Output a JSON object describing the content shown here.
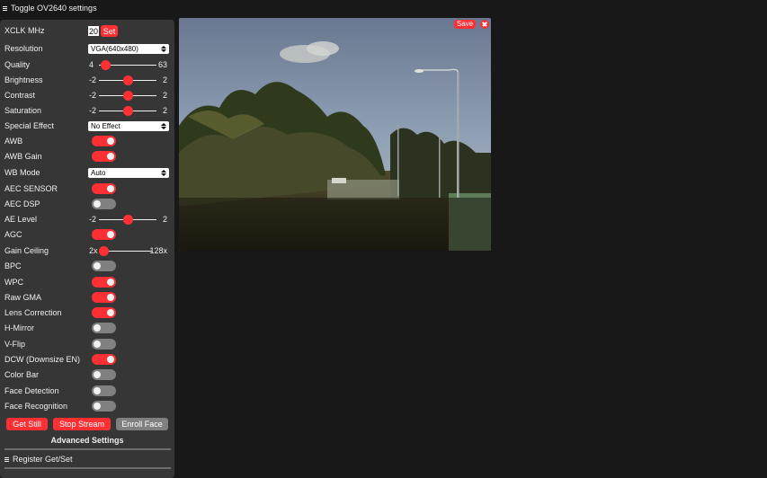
{
  "header": {
    "toggle_label": "Toggle OV2640 settings",
    "icon": "menu-icon"
  },
  "xclk": {
    "label": "XCLK MHz",
    "value": "20",
    "set_label": "Set"
  },
  "selects": {
    "resolution": {
      "label": "Resolution",
      "value": "VGA(640x480)"
    },
    "special_effect": {
      "label": "Special Effect",
      "value": "No Effect"
    },
    "wb_mode": {
      "label": "WB Mode",
      "value": "Auto"
    }
  },
  "sliders": {
    "quality": {
      "label": "Quality",
      "min": "4",
      "max": "63",
      "value": 10
    },
    "brightness": {
      "label": "Brightness",
      "min": "-2",
      "max": "2",
      "value": 0
    },
    "contrast": {
      "label": "Contrast",
      "min": "-2",
      "max": "2",
      "value": 0
    },
    "saturation": {
      "label": "Saturation",
      "min": "-2",
      "max": "2",
      "value": 0
    },
    "ae_level": {
      "label": "AE Level",
      "min": "-2",
      "max": "2",
      "value": 0
    },
    "gain_ceiling": {
      "label": "Gain Ceiling",
      "min": "2x",
      "max": "128x",
      "value": 0
    }
  },
  "toggles": {
    "awb": {
      "label": "AWB",
      "on": true
    },
    "awb_gain": {
      "label": "AWB Gain",
      "on": true
    },
    "aec_sensor": {
      "label": "AEC SENSOR",
      "on": true
    },
    "aec_dsp": {
      "label": "AEC DSP",
      "on": false
    },
    "agc": {
      "label": "AGC",
      "on": true
    },
    "bpc": {
      "label": "BPC",
      "on": false
    },
    "wpc": {
      "label": "WPC",
      "on": true
    },
    "raw_gma": {
      "label": "Raw GMA",
      "on": true
    },
    "lenc": {
      "label": "Lens Correction",
      "on": true
    },
    "hmirror": {
      "label": "H-Mirror",
      "on": false
    },
    "vflip": {
      "label": "V-Flip",
      "on": false
    },
    "dcw": {
      "label": "DCW (Downsize EN)",
      "on": true
    },
    "colorbar": {
      "label": "Color Bar",
      "on": false
    },
    "face_detect": {
      "label": "Face Detection",
      "on": false
    },
    "face_recog": {
      "label": "Face Recognition",
      "on": false
    }
  },
  "actions": {
    "get_still": "Get Still",
    "stop_stream": "Stop Stream",
    "enroll_face": "Enroll Face"
  },
  "advanced": {
    "title": "Advanced Settings",
    "register_label": "Register Get/Set"
  },
  "stream": {
    "save_label": "Save"
  },
  "colors": {
    "accent": "#ff3034",
    "panel": "#363636",
    "background": "#181818",
    "toggle_off": "#808080"
  }
}
